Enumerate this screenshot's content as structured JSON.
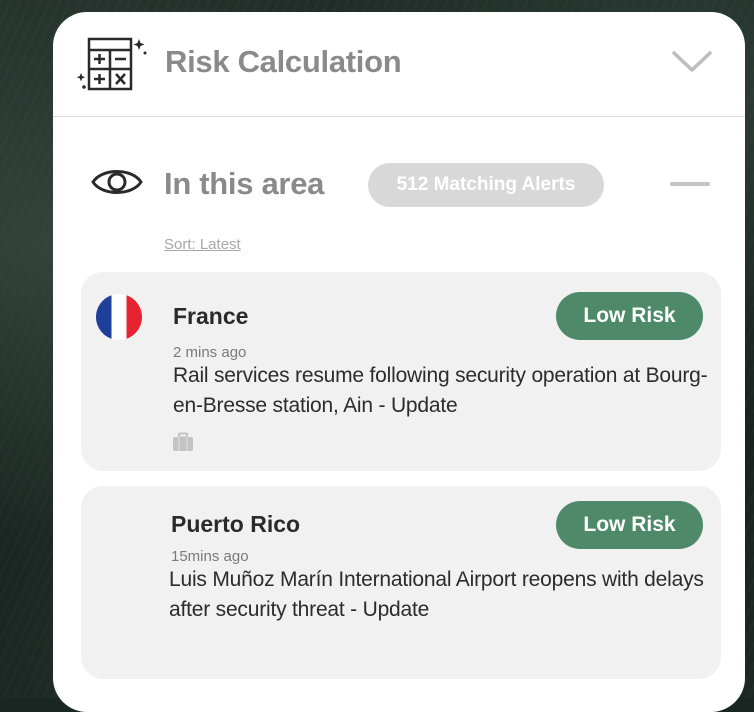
{
  "header": {
    "title": "Risk Calculation",
    "icon": "calculator-icon",
    "toggle_icon": "chevron-down-icon"
  },
  "area": {
    "title": "In this area",
    "icon": "eye-icon",
    "alerts_badge": "512 Matching Alerts",
    "collapse_icon": "minus-icon",
    "sort_label": "Sort: Latest"
  },
  "alerts": [
    {
      "country": "France",
      "flag": "france-flag",
      "time": "2 mins ago",
      "headline": "Rail services resume following security operation at Bourg-en-Bresse station, Ain - Update",
      "risk": "Low Risk",
      "category_icon": "briefcase-icon"
    },
    {
      "country": "Puerto Rico",
      "time": "15mins ago",
      "headline": "Luis Muñoz Marín International Airport reopens with delays after security threat - Update",
      "risk": "Low Risk"
    }
  ],
  "colors": {
    "risk_low": "#4e8a6a",
    "muted_text": "#8a8a8a",
    "card_bg": "#f1f1f1",
    "pill_bg": "#d8d8d8"
  }
}
